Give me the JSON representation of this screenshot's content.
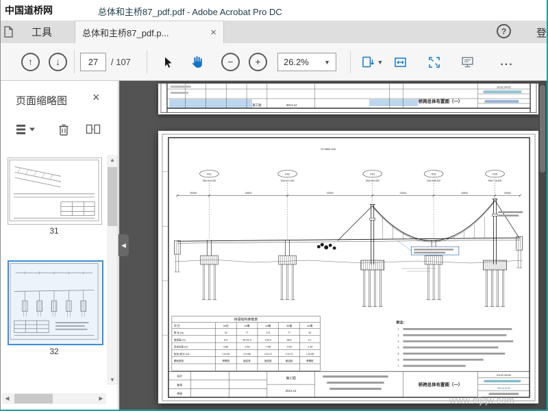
{
  "window": {
    "watermark_top": "中国道桥网",
    "title": "总体和主桥87_pdf.pdf - Adobe Acrobat Pro DC",
    "watermark_bottom": "www.cfjqw.com"
  },
  "tab_bar": {
    "tools_tab": "工具",
    "doc_tab": "总体和主桥87_pdf.p...",
    "close_glyph": "×",
    "help_glyph": "?",
    "login_label": "登录"
  },
  "toolbar": {
    "page_current": "27",
    "page_total": "/ 107",
    "zoom": "26.2%",
    "more_glyph": "..."
  },
  "panel": {
    "title": "页面缩略图",
    "close_glyph": "×",
    "thumb_labels": [
      "31",
      "32"
    ]
  },
  "drawing": {
    "curve_note": "R=3500.000",
    "pier_ids": [
      "P01",
      "P02",
      "P03",
      "P04",
      "P05"
    ],
    "stations": [
      "K54+344.000",
      "K54+421.000",
      "K54+594.000",
      "K54+658.300",
      "K54+716.500"
    ],
    "dims": [
      "29400",
      "24600",
      "23200",
      "23200",
      "24600",
      "29400"
    ],
    "notes_title": "附注：",
    "note_numbers": [
      "1.",
      "2.",
      "3.",
      "4.",
      "5.",
      "6.",
      "7."
    ],
    "table": {
      "caption": "桥梁结构参数表",
      "header": [
        "项 目",
        "0#台",
        "1#墩",
        "2#墩",
        "3#墩",
        "4#墩"
      ],
      "rows": [
        [
          "跨 径 (m)",
          "30",
          "77",
          "173",
          "77",
          "30"
        ],
        [
          "墩塔高 (m)",
          "8.5",
          "25.0/2.0",
          "102.5",
          "98.6",
          "9.1"
        ],
        [
          "承台标高 (m)",
          "0.85",
          "-2.50",
          "-7.56",
          "-4.50",
          "-1.50"
        ],
        [
          "桩径×桩长 (m)",
          "1.5×45",
          "2.0×65",
          "2.5×72",
          "2.5×70",
          "1.5×48"
        ],
        [
          "基础类型",
          "摩擦桩",
          "嵌岩桩",
          "嵌岩桩",
          "嵌岩桩",
          "摩擦桩"
        ]
      ]
    },
    "title_block": {
      "left_rows": [
        "设计",
        "复核",
        "审核"
      ],
      "stage": "施工图",
      "date": "2013.12",
      "project_no": "2013Z.09Y05",
      "title": "桥跨总体布置图（一）",
      "drawing_no": "S03-Ⅲ-Ⅳ-02"
    }
  },
  "strip": {
    "stage": "施工图",
    "date": "2013.12",
    "title": "桥跨总体布置图（一）",
    "project_no": "2013Z.09Y05"
  }
}
